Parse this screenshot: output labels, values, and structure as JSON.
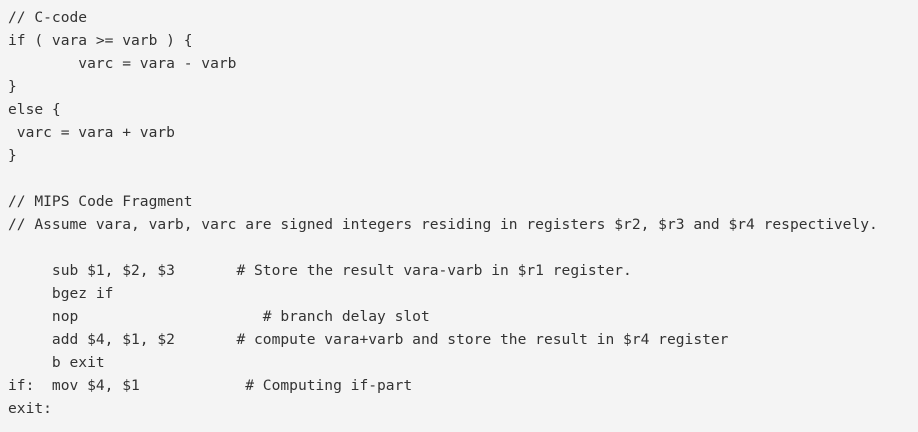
{
  "code": {
    "lines": [
      "// C-code",
      "if ( vara >= varb ) {",
      "        varc = vara - varb",
      "}",
      "else {",
      " varc = vara + varb",
      "}",
      "",
      "// MIPS Code Fragment",
      "// Assume vara, varb, varc are signed integers residing in registers $r2, $r3 and $r4 respectively.",
      "",
      "     sub $1, $2, $3       # Store the result vara-varb in $r1 register.",
      "     bgez if",
      "     nop                     # branch delay slot",
      "     add $4, $1, $2       # compute vara+varb and store the result in $r4 register",
      "     b exit",
      "if:  mov $4, $1            # Computing if-part",
      "exit:"
    ]
  }
}
